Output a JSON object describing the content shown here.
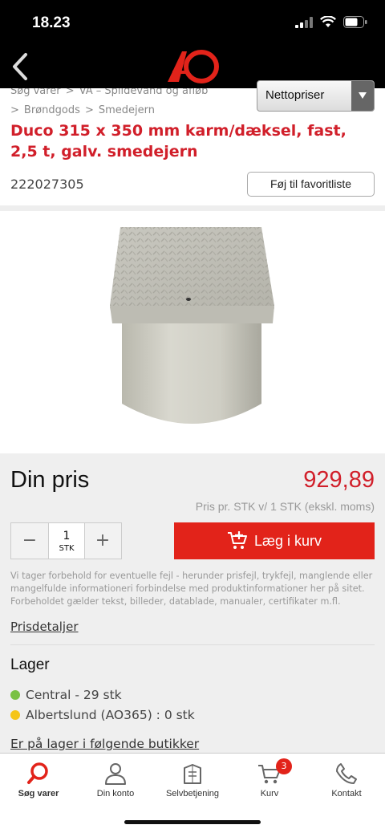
{
  "status": {
    "time": "18.23"
  },
  "colors": {
    "accent": "#d11f2a",
    "cart_button": "#e2231a",
    "stock_green": "#7ac143",
    "stock_yellow": "#f5c518"
  },
  "breadcrumbs": {
    "row1": [
      "Søg varer",
      "VA – Spildevand og afløb"
    ],
    "row2": [
      "Brøndgods",
      "Smedejern"
    ]
  },
  "price_select": {
    "label": "Nettopriser"
  },
  "product": {
    "title": "Duco 315 x 350 mm karm/dæksel, fast, 2,5 t, galv. smedejern",
    "sku": "222027305",
    "favorite_label": "Føj til favoritliste"
  },
  "pricing": {
    "heading": "Din pris",
    "price": "929,89",
    "per_unit": "Pris pr. STK v/ 1 STK (ekskl. moms)",
    "qty_minus": "−",
    "qty_plus": "+",
    "qty_value": "1",
    "qty_unit": "STK",
    "add_to_cart": "Læg i kurv",
    "disclaimer": "Vi tager forbehold for eventuelle fejl - herunder prisfejl, trykfejl, manglende eller mangelfulde informationeri forbindelse med produktinformationer her på sitet. Forbeholdet gælder tekst, billeder, datablade, manualer, certifikater m.fl.",
    "details_link": "Prisdetaljer"
  },
  "stock": {
    "heading": "Lager",
    "rows": [
      "Central - 29 stk",
      "Albertslund (AO365) : 0 stk"
    ],
    "stores_link": "Er på lager i følgende butikker"
  },
  "tabs": [
    {
      "label": "Søg varer",
      "icon": "search-icon"
    },
    {
      "label": "Din konto",
      "icon": "user-icon"
    },
    {
      "label": "Selvbetjening",
      "icon": "self-service-icon"
    },
    {
      "label": "Kurv",
      "icon": "cart-icon",
      "badge": "3"
    },
    {
      "label": "Kontakt",
      "icon": "phone-icon"
    }
  ],
  "logo": {
    "text": "AO"
  }
}
